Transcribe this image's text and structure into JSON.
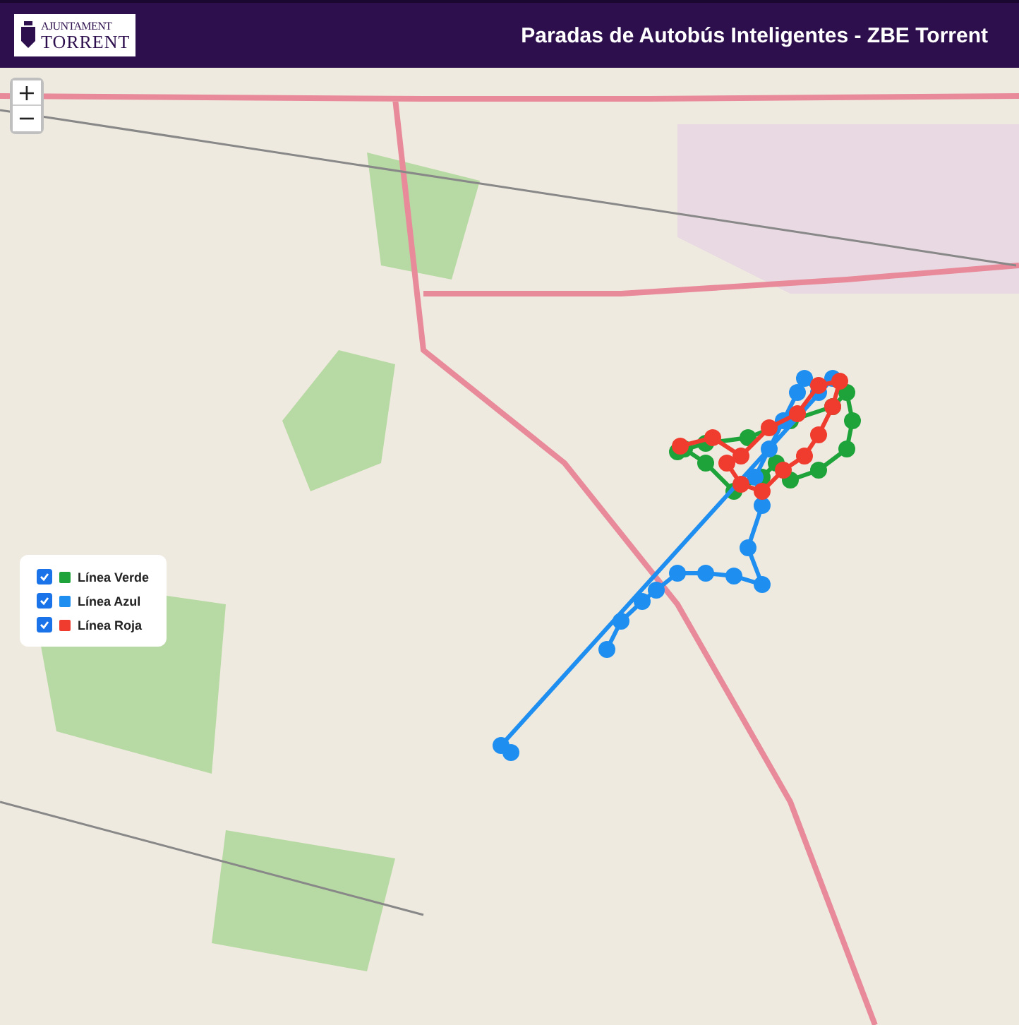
{
  "header": {
    "logo": {
      "line_1": "AJUNTAMENT",
      "line_2": "TORRENT"
    },
    "title": "Paradas de Autobús Inteligentes - ZBE Torrent"
  },
  "zoom_controls": [
    "+",
    "−"
  ],
  "legend": [
    {
      "label": "Línea Verde",
      "checked": true,
      "color": "#1ea33a"
    },
    {
      "label": "Línea Azul",
      "checked": true,
      "color": "#1e8ff0"
    },
    {
      "label": "Línea Roja",
      "checked": true,
      "color": "#f03c2e"
    }
  ]
}
